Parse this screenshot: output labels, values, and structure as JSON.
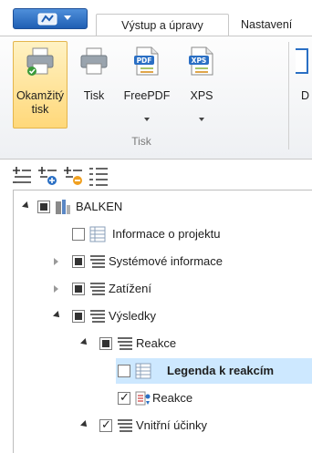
{
  "ribbon": {
    "tabs": [
      {
        "label": "Výstup a úpravy",
        "active": true
      },
      {
        "label": "Nastavení",
        "active": false
      }
    ],
    "buttons": [
      {
        "label": "Okamžitý",
        "label2": "tisk",
        "icon": "printer-check-icon",
        "highlighted": true
      },
      {
        "label": "Tisk",
        "label2": "",
        "icon": "printer-icon"
      },
      {
        "label": "FreePDF",
        "label2": "",
        "icon": "pdf-file-icon",
        "dropdown": true
      },
      {
        "label": "XPS",
        "label2": "",
        "icon": "xps-file-icon",
        "dropdown": true
      },
      {
        "label": "D",
        "label2": "",
        "icon": "partial-icon"
      }
    ],
    "group_label": "Tisk",
    "colors": {
      "highlight": "#ffd87a",
      "app_button": "#1f5fb4"
    }
  },
  "tree_toolbar": {
    "icons": [
      "collapse-all-icon",
      "expand-add-icon",
      "collapse-remove-icon",
      "list-icon"
    ]
  },
  "tree": {
    "items": [
      {
        "label": "BALKEN",
        "icon": "model-icon",
        "check": "partial",
        "arrow": "expanded",
        "level": 0
      },
      {
        "label": "Informace o projektu",
        "icon": "table-icon",
        "check": "unchecked",
        "arrow": "none",
        "level": 1
      },
      {
        "label": "Systémové informace",
        "icon": "list-icon",
        "check": "partial",
        "arrow": "collapsed",
        "level": 1
      },
      {
        "label": "Zatížení",
        "icon": "list-icon",
        "check": "partial",
        "arrow": "collapsed",
        "level": 1
      },
      {
        "label": "Výsledky",
        "icon": "list-icon",
        "check": "partial",
        "arrow": "expanded",
        "level": 1
      },
      {
        "label": "Reakce",
        "icon": "list-icon",
        "check": "partial",
        "arrow": "expanded",
        "level": 2
      },
      {
        "label": "Legenda k reakcím",
        "icon": "table-icon",
        "check": "unchecked",
        "arrow": "none",
        "level": 3,
        "selected": true
      },
      {
        "label": "Reakce",
        "icon": "reaction-icon",
        "check": "checked",
        "arrow": "none",
        "level": 3
      },
      {
        "label": "Vnitřní účinky",
        "icon": "list-icon",
        "check": "checked",
        "arrow": "expanded",
        "level": 2
      }
    ]
  }
}
